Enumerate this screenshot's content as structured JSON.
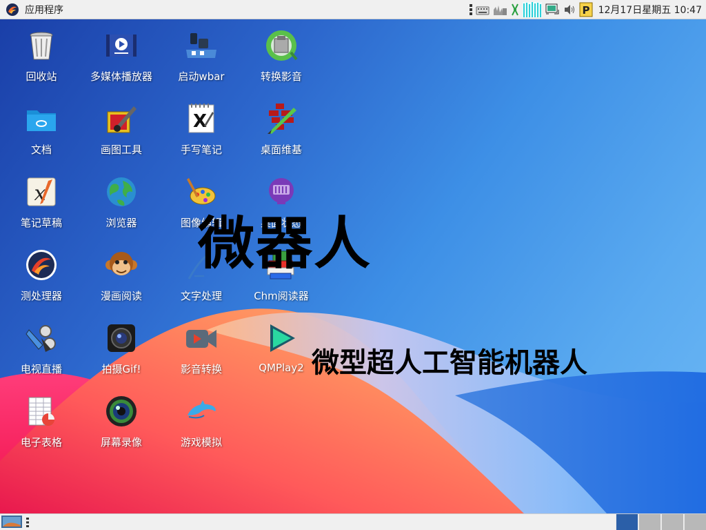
{
  "top_panel": {
    "menu_label": "应用程序",
    "clock": "12月17日星期五 10:47",
    "tray_icons": [
      "handle-icon",
      "keyboard-icon",
      "network-monitor-icon",
      "cursor-icon",
      "cpu-monitor-icon",
      "network-icon",
      "volume-icon",
      "parking-icon"
    ]
  },
  "desktop": {
    "icons": [
      {
        "label": "回收站",
        "icon": "trash-icon"
      },
      {
        "label": "多媒体播放器",
        "icon": "media-player-icon"
      },
      {
        "label": "启动wbar",
        "icon": "dock-icon"
      },
      {
        "label": "转换影音",
        "icon": "video-convert-icon"
      },
      {
        "label": "文档",
        "icon": "folder-icon"
      },
      {
        "label": "画图工具",
        "icon": "paint-icon"
      },
      {
        "label": "手写笔记",
        "icon": "xournal-icon"
      },
      {
        "label": "桌面维基",
        "icon": "wiki-icon"
      },
      {
        "label": "笔记草稿",
        "icon": "math-note-icon"
      },
      {
        "label": "浏览器",
        "icon": "globe-icon"
      },
      {
        "label": "图像编辑",
        "icon": "palette-icon"
      },
      {
        "label": "桌面状态",
        "icon": "status-monitor-icon"
      },
      {
        "label": "测处理器",
        "icon": "processor-icon"
      },
      {
        "label": "漫画阅读",
        "icon": "monkey-icon"
      },
      {
        "label": "文字处理",
        "icon": "word-processor-icon"
      },
      {
        "label": "Chm阅读器",
        "icon": "books-icon"
      },
      {
        "label": "电视直播",
        "icon": "tv-icon"
      },
      {
        "label": "拍摄Gif!",
        "icon": "camera-icon"
      },
      {
        "label": "影音转换",
        "icon": "video-camera-icon"
      },
      {
        "label": "QMPlay2",
        "icon": "play-icon"
      },
      {
        "label": "电子表格",
        "icon": "spreadsheet-icon"
      },
      {
        "label": "屏幕录像",
        "icon": "lens-icon"
      },
      {
        "label": "游戏模拟",
        "icon": "dolphin-icon"
      }
    ],
    "big_title": "微器人",
    "subtitle": "微型超人工智能机器人"
  },
  "colors": {
    "panel_bg": "#f0f0f0",
    "active_workspace": "#2b5fa8",
    "inactive_workspace": "#b8b8b8"
  },
  "bottom_panel": {
    "workspaces": [
      {
        "name": "workspace-1",
        "active": true
      },
      {
        "name": "workspace-2",
        "active": false
      },
      {
        "name": "workspace-3",
        "active": false
      },
      {
        "name": "workspace-4",
        "active": false
      }
    ]
  }
}
